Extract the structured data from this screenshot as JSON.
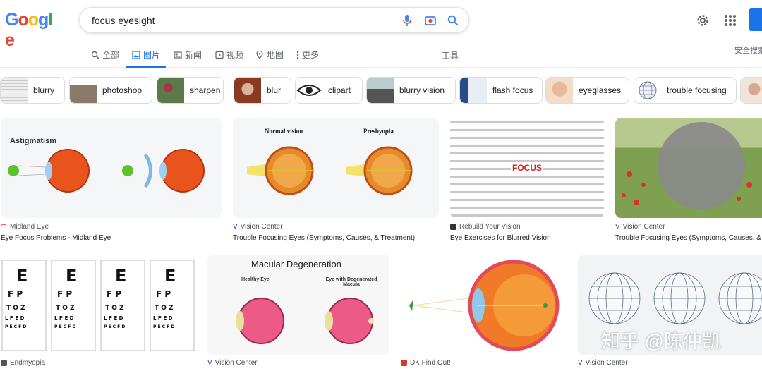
{
  "logo": {
    "letters": [
      "G",
      "o",
      "o",
      "g",
      "l",
      "e"
    ],
    "colors": [
      "#4285f4",
      "#ea4335",
      "#fbbc05",
      "#4285f4",
      "#34a853",
      "#ea4335"
    ]
  },
  "search": {
    "query": "focus eyesight"
  },
  "tabs": [
    {
      "label": "全部",
      "icon": "search-icon"
    },
    {
      "label": "图片",
      "icon": "image-icon",
      "active": true
    },
    {
      "label": "新闻",
      "icon": "news-icon"
    },
    {
      "label": "视频",
      "icon": "video-icon"
    },
    {
      "label": "地图",
      "icon": "map-pin-icon"
    },
    {
      "label": "更多",
      "icon": "more-dots-icon"
    }
  ],
  "tools_label": "工具",
  "safesearch_label": "安全搜索",
  "chips": [
    "blurry",
    "photoshop",
    "sharpen",
    "blur",
    "clipart",
    "blurry vision",
    "flash focus",
    "eyeglasses",
    "trouble focusing"
  ],
  "results_row1": [
    {
      "source": "Midland Eye",
      "title": "Eye Focus Problems - Midland Eye",
      "image_heading": "Astigmatism"
    },
    {
      "source": "Vision Center",
      "title": "Trouble Focusing Eyes (Symptoms, Causes, & Treatment)",
      "image_heading_left": "Normal vision",
      "image_heading_right": "Presbyopia"
    },
    {
      "source": "Rebuild Your Vision",
      "title": "Eye Exercises for Blurred Vision",
      "image_heading": "FOCUS"
    },
    {
      "source": "Vision Center",
      "title": "Trouble Focusing Eyes (Symptoms, Causes, & T"
    }
  ],
  "results_row2": [
    {
      "source": "Endmyopia"
    },
    {
      "source": "Vision Center",
      "image_heading": "Macular Degeneration",
      "image_left": "Healthy Eye",
      "image_right": "Eye with Degenerated Macula"
    },
    {
      "source": "DK Find Out!"
    },
    {
      "source": "Vision Center"
    }
  ],
  "watermark": "知乎 @陈仲凯",
  "colors": {
    "accent": "#1a73e8",
    "eye_orange": "#e8541c"
  }
}
